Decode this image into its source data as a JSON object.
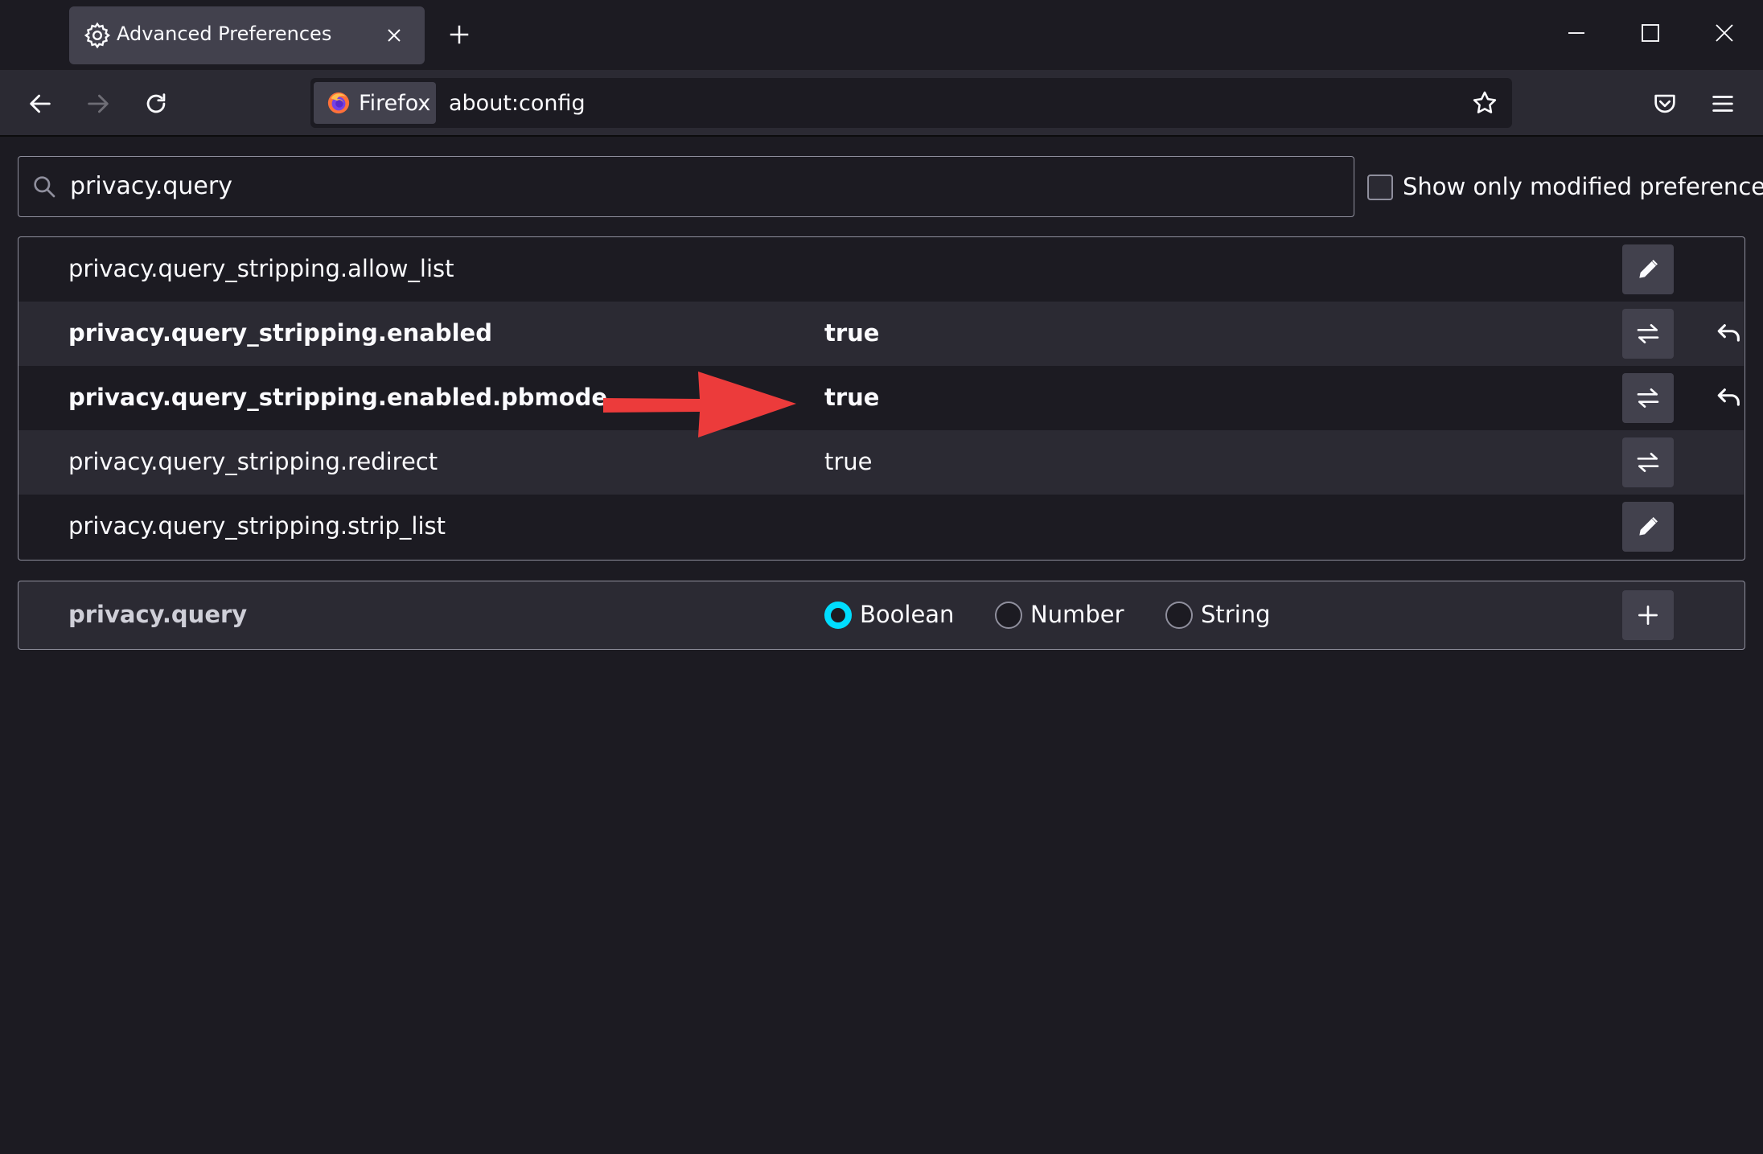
{
  "tab": {
    "title": "Advanced Preferences",
    "icon": "gear-icon"
  },
  "urlbar": {
    "identity_label": "Firefox",
    "url": "about:config"
  },
  "search": {
    "value": "privacy.query"
  },
  "filter": {
    "label": "Show only modified preferences",
    "checked": false
  },
  "prefs": [
    {
      "name": "privacy.query_stripping.allow_list",
      "value": "",
      "modified": false,
      "action": "edit"
    },
    {
      "name": "privacy.query_stripping.enabled",
      "value": "true",
      "modified": true,
      "action": "toggle"
    },
    {
      "name": "privacy.query_stripping.enabled.pbmode",
      "value": "true",
      "modified": true,
      "action": "toggle"
    },
    {
      "name": "privacy.query_stripping.redirect",
      "value": "true",
      "modified": false,
      "action": "toggle"
    },
    {
      "name": "privacy.query_stripping.strip_list",
      "value": "",
      "modified": false,
      "action": "edit"
    }
  ],
  "add_pref": {
    "name": "privacy.query",
    "types": [
      "Boolean",
      "Number",
      "String"
    ],
    "selected": "Boolean"
  },
  "colors": {
    "background": "#1c1b22",
    "toolbar": "#2b2a33",
    "accent": "#00ddff",
    "annotation_arrow": "#ec3b3b"
  }
}
